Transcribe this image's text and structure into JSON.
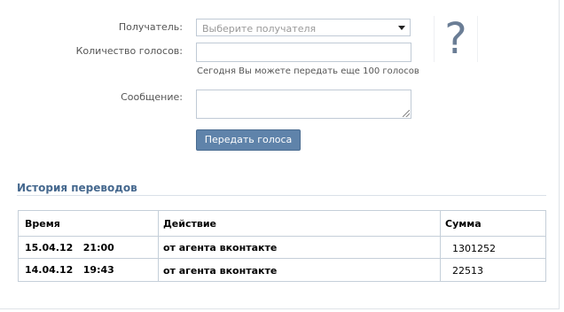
{
  "form": {
    "recipient_label": "Получатель:",
    "recipient_placeholder": "Выберите получателя",
    "votes_label": "Количество голосов:",
    "votes_value": "",
    "votes_hint": "Сегодня Вы можете передать еще 100 голосов",
    "message_label": "Сообщение:",
    "message_value": "",
    "submit_label": "Передать голоса"
  },
  "avatar": {
    "placeholder_glyph": "?"
  },
  "history": {
    "title": "История переводов",
    "columns": [
      "Время",
      "Действие",
      "Сумма"
    ],
    "rows": [
      {
        "time": "15.04.12   21:00",
        "action": "от агента вконтакте",
        "sum": "1301252"
      },
      {
        "time": "14.04.12   19:43",
        "action": "от агента вконтакте",
        "sum": "22513"
      }
    ]
  }
}
